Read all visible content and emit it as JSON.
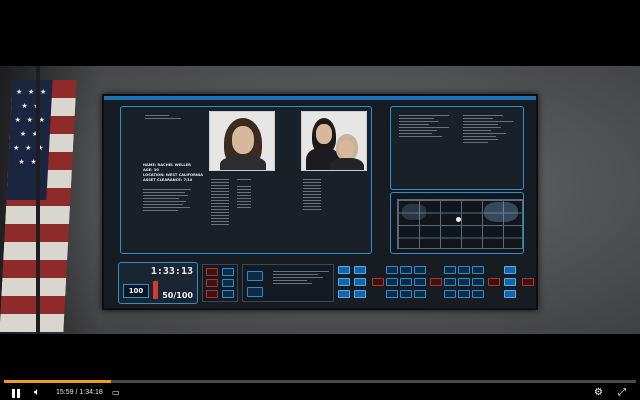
{
  "player": {
    "current_time": "15:59",
    "separator": "/",
    "duration": "1:34:18",
    "progress_fraction": 0.17,
    "accent_color": "#f29c1a",
    "icons": [
      "pause-icon",
      "volume-icon",
      "subtitles-icon",
      "settings-icon",
      "fullscreen-icon"
    ]
  },
  "screen": {
    "profile": {
      "name_line": "NAME: RACHEL WELLER",
      "age_line": "AGE: 30",
      "location_line": "LOCATION: WEST CALIFORNIA",
      "clearance_line": "ASSET CLEARANCE: 7/10"
    },
    "control": {
      "timer": "1:33:13",
      "count": "100",
      "ratio": "50/100"
    },
    "colors": {
      "panel_border": "#2a8fd0",
      "alert_red": "#d23a2e"
    }
  }
}
